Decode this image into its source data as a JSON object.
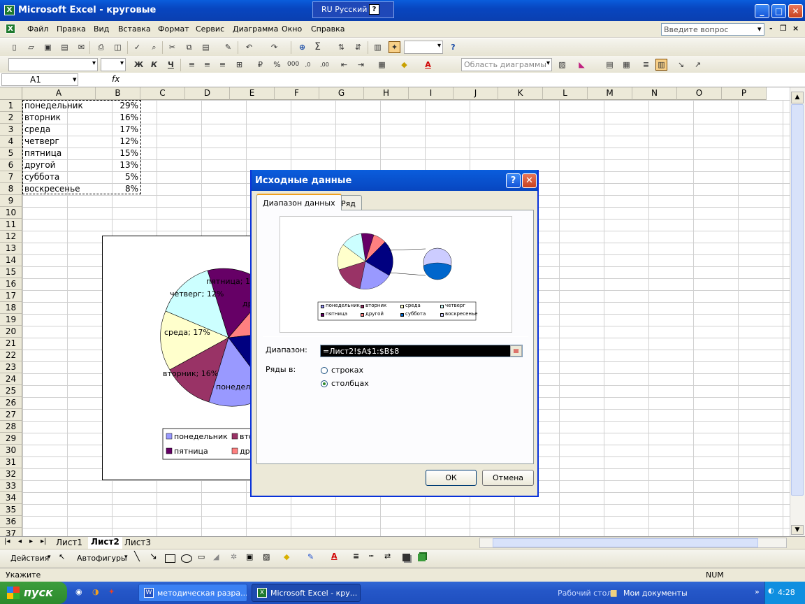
{
  "window": {
    "title": "Microsoft Excel - круговые",
    "lang": "RU Русский"
  },
  "menu": [
    "Файл",
    "Правка",
    "Вид",
    "Вставка",
    "Формат",
    "Сервис",
    "Диаграмма",
    "Окно",
    "Справка"
  ],
  "help_placeholder": "Введите вопрос",
  "chart_toolbar": {
    "area_combo": "Область диаграммы"
  },
  "formula_bar": {
    "name_box": "A1",
    "fx": "fx"
  },
  "columns": [
    "A",
    "B",
    "C",
    "D",
    "E",
    "F",
    "G",
    "H",
    "I",
    "J",
    "K",
    "L",
    "M",
    "N",
    "O",
    "P"
  ],
  "rows": [
    "1",
    "2",
    "3",
    "4",
    "5",
    "6",
    "7",
    "8",
    "9",
    "10",
    "11",
    "12",
    "13",
    "14",
    "15",
    "16",
    "17",
    "18",
    "19",
    "20",
    "21",
    "22",
    "23",
    "24",
    "25",
    "26",
    "27",
    "28",
    "29",
    "30",
    "31",
    "32",
    "33",
    "34",
    "35",
    "36",
    "37"
  ],
  "cells": [
    {
      "a": "понедельник",
      "b": "29%"
    },
    {
      "a": "вторник",
      "b": "16%"
    },
    {
      "a": "среда",
      "b": "17%"
    },
    {
      "a": "четверг",
      "b": "12%"
    },
    {
      "a": "пятница",
      "b": "15%"
    },
    {
      "a": "другой",
      "b": "13%"
    },
    {
      "a": "суббота",
      "b": "5%"
    },
    {
      "a": "воскресенье",
      "b": "8%"
    }
  ],
  "embedded_chart": {
    "labels": [
      "пятница; 15",
      "четверг; 12%",
      "среда; 17%",
      "вторник; 16%",
      "понедель",
      "др"
    ],
    "legend": [
      "понедельник",
      "вто",
      "пятница",
      "др"
    ]
  },
  "dialog": {
    "title": "Исходные данные",
    "tabs": [
      "Диапазон данных",
      "Ряд"
    ],
    "range_label": "Диапазон:",
    "range_value": "=Лист2!$A$1:$B$8",
    "series_label": "Ряды в:",
    "radio_rows": "строках",
    "radio_cols": "столбцах",
    "ok": "ОК",
    "cancel": "Отмена",
    "preview_legend": [
      "понедельник",
      "вторник",
      "среда",
      "четверг",
      "пятница",
      "другой",
      "суббота",
      "воскресенье"
    ]
  },
  "sheets": [
    "Лист1",
    "Лист2",
    "Лист3"
  ],
  "drawing": {
    "actions": "Действия",
    "autoshapes": "Автофигуры"
  },
  "status": {
    "text": "Укажите",
    "num": "NUM"
  },
  "taskbar": {
    "start": "пуск",
    "tasks": [
      "методическая разра...",
      "Microsoft Excel - кру..."
    ],
    "desktop": "Рабочий стол",
    "mydocs": "Мои документы",
    "clock": "4:28"
  },
  "colors": {
    "ponedelnik": "#9999ff",
    "vtornik": "#993366",
    "sreda": "#ffffcc",
    "chetverg": "#ccffff",
    "pyatnitsa": "#660066",
    "drugoy": "#ff8080",
    "subbota": "#0066cc",
    "voskresenye": "#ccccff",
    "navy": "#000080"
  }
}
